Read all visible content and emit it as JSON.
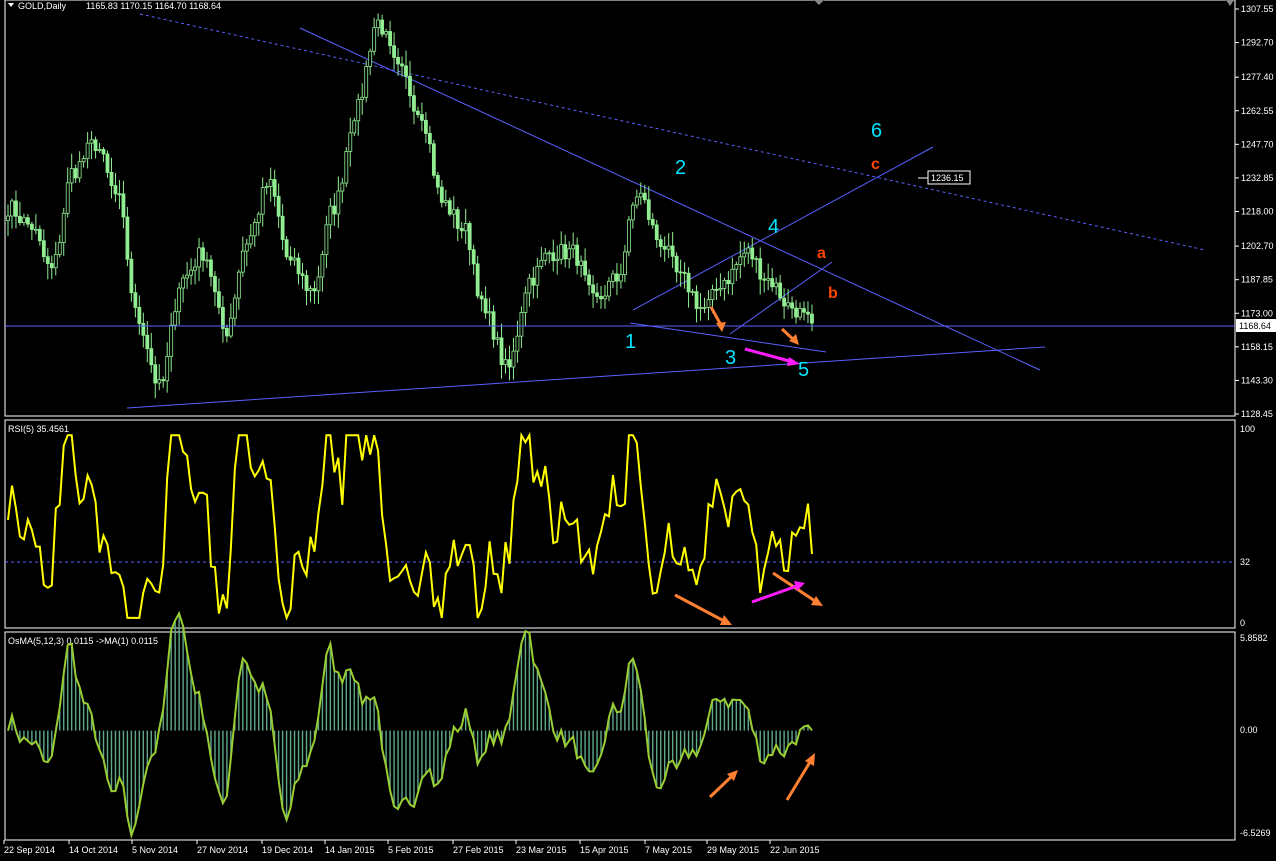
{
  "header": {
    "symbol": "GOLD,Daily",
    "ohlc": "1165.83 1170.15 1164.70 1168.64"
  },
  "colors": {
    "background": "#000000",
    "border": "#ffffff",
    "candles": "#90ee90",
    "trendlines": "#5a62ff",
    "wave_count": "#00e5ff",
    "abc": "#ff4500",
    "arrow_orange": "#ff8030",
    "arrow_magenta": "#ff1cff",
    "rsi_line": "#ffff00",
    "osma_line": "#9acd32",
    "osma_hist": "#5fa88a",
    "price_marker": "#ffffff"
  },
  "price_panel": {
    "y_ticks": [
      "1307.55",
      "1292.70",
      "1277.40",
      "1262.55",
      "1247.70",
      "1232.85",
      "1218.00",
      "1202.70",
      "1187.85",
      "1173.00",
      "1158.15",
      "1143.30",
      "1128.45"
    ],
    "current_price": "1168.64",
    "marked_price": "1236.15",
    "wave_labels": [
      "1",
      "2",
      "3",
      "4",
      "5",
      "6"
    ],
    "abc_labels": [
      "a",
      "b",
      "c"
    ]
  },
  "rsi_panel": {
    "title": "RSI(5) 35.4561",
    "y_ticks": [
      "100",
      "32",
      "0"
    ],
    "level": 32
  },
  "osma_panel": {
    "title": "OsMA(5,12,3) 0.0115  ->MA(1) 0.0115",
    "y_ticks": [
      "5.8582",
      "0.00",
      "-6.5269"
    ]
  },
  "x_axis": {
    "labels": [
      "22 Sep 2014",
      "14 Oct 2014",
      "5 Nov 2014",
      "27 Nov 2014",
      "19 Dec 2014",
      "14 Jan 2015",
      "5 Feb 2015",
      "27 Feb 2015",
      "23 Mar 2015",
      "15 Apr 2015",
      "7 May 2015",
      "29 May 2015",
      "22 Jun 2015"
    ]
  },
  "chart_data": {
    "type": "candlestick",
    "instrument": "GOLD",
    "timeframe": "Daily",
    "ylim": [
      1128.45,
      1307.55
    ],
    "last_close": 1168.64,
    "price_path_knots": [
      [
        "22 Sep 2014",
        1220
      ],
      [
        "29 Sep 2014",
        1212
      ],
      [
        "3 Oct 2014",
        1192
      ],
      [
        "14 Oct 2014",
        1236
      ],
      [
        "21 Oct 2014",
        1248
      ],
      [
        "28 Oct 2014",
        1225
      ],
      [
        "3 Nov 2014",
        1170
      ],
      [
        "7 Nov 2014",
        1140
      ],
      [
        "14 Nov 2014",
        1188
      ],
      [
        "21 Nov 2014",
        1200
      ],
      [
        "27 Nov 2014",
        1165
      ],
      [
        "2 Dec 2014",
        1205
      ],
      [
        "10 Dec 2014",
        1230
      ],
      [
        "19 Dec 2014",
        1195
      ],
      [
        "30 Dec 2014",
        1183
      ],
      [
        "9 Jan 2015",
        1220
      ],
      [
        "14 Jan 2015",
        1262
      ],
      [
        "22 Jan 2015",
        1302
      ],
      [
        "29 Jan 2015",
        1280
      ],
      [
        "5 Feb 2015",
        1262
      ],
      [
        "16 Feb 2015",
        1222
      ],
      [
        "27 Feb 2015",
        1210
      ],
      [
        "6 Mar 2015",
        1172
      ],
      [
        "17 Mar 2015",
        1148
      ],
      [
        "23 Mar 2015",
        1188
      ],
      [
        "31 Mar 2015",
        1200
      ],
      [
        "15 Apr 2015",
        1200
      ],
      [
        "24 Apr 2015",
        1178
      ],
      [
        "5 May 2015",
        1188
      ],
      [
        "15 May 2015",
        1226
      ],
      [
        "22 May 2015",
        1205
      ],
      [
        "29 May 2015",
        1188
      ],
      [
        "3 Jun 2015",
        1175
      ],
      [
        "12 Jun 2015",
        1188
      ],
      [
        "18 Jun 2015",
        1200
      ],
      [
        "22 Jun 2015",
        1188
      ],
      [
        "26 Jun 2015",
        1176
      ],
      [
        "30 Jun 2015",
        1168.64
      ]
    ],
    "rsi": {
      "name": "RSI(5)",
      "last": 35.4561,
      "ylim": [
        0,
        100
      ],
      "level": 32
    },
    "osma": {
      "name": "OsMA(5,12,3)",
      "last": 0.0115,
      "ylim": [
        -6.5269,
        5.8582
      ]
    }
  }
}
